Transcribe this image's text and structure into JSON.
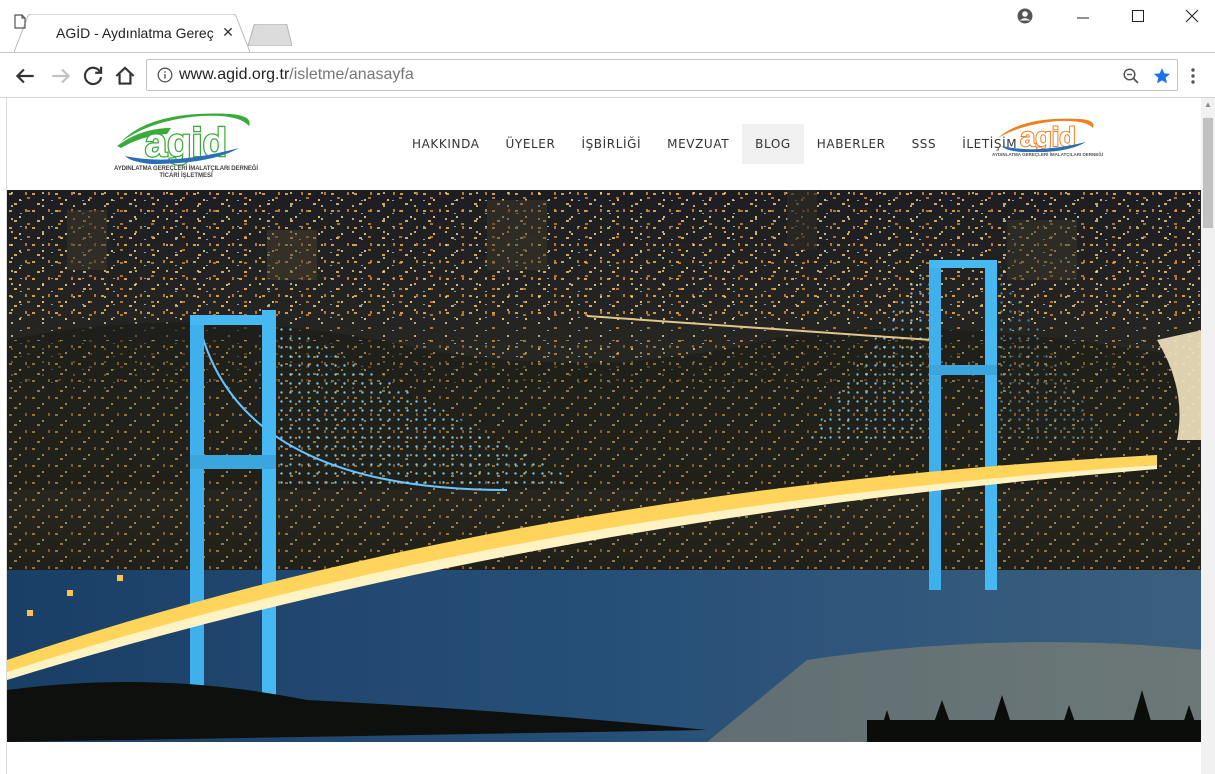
{
  "browser": {
    "tab_title": "AGİD - Aydınlatma Gereç",
    "url_host": "www.agid.org.tr",
    "url_path": "/isletme/anasayfa",
    "icons": {
      "tab": "document-icon",
      "close": "close-icon",
      "account": "account-icon",
      "minimize": "minimize-icon",
      "maximize": "maximize-icon",
      "window_close": "window-close-icon",
      "back": "back-arrow-icon",
      "forward": "forward-arrow-icon",
      "reload": "reload-icon",
      "home": "home-icon",
      "info": "info-icon",
      "zoom": "zoom-icon",
      "bookmark": "star-icon",
      "menu": "kebab-menu-icon"
    },
    "colors": {
      "star": "#1a73e8"
    }
  },
  "site": {
    "logo_left": {
      "wordmark": "agid",
      "line1": "AYDINLATMA GEREÇLERİ İMALATÇILARI DERNEĞİ",
      "line2": "TİCARİ İŞLETMESİ"
    },
    "logo_right": {
      "wordmark": "agid",
      "line1": "AYDINLATMA GEREÇLERİ İMALATÇILARI DERNEĞİ"
    },
    "nav": [
      "HAKKINDA",
      "ÜYELER",
      "İŞBİRLİĞİ",
      "MEVZUAT",
      "BLOG",
      "HABERLER",
      "SSS",
      "İLETİŞİM"
    ],
    "nav_active": "BLOG",
    "colors": {
      "green": "#3aab3a",
      "orange": "#f07f1f",
      "blue": "#2a6fb5"
    }
  }
}
